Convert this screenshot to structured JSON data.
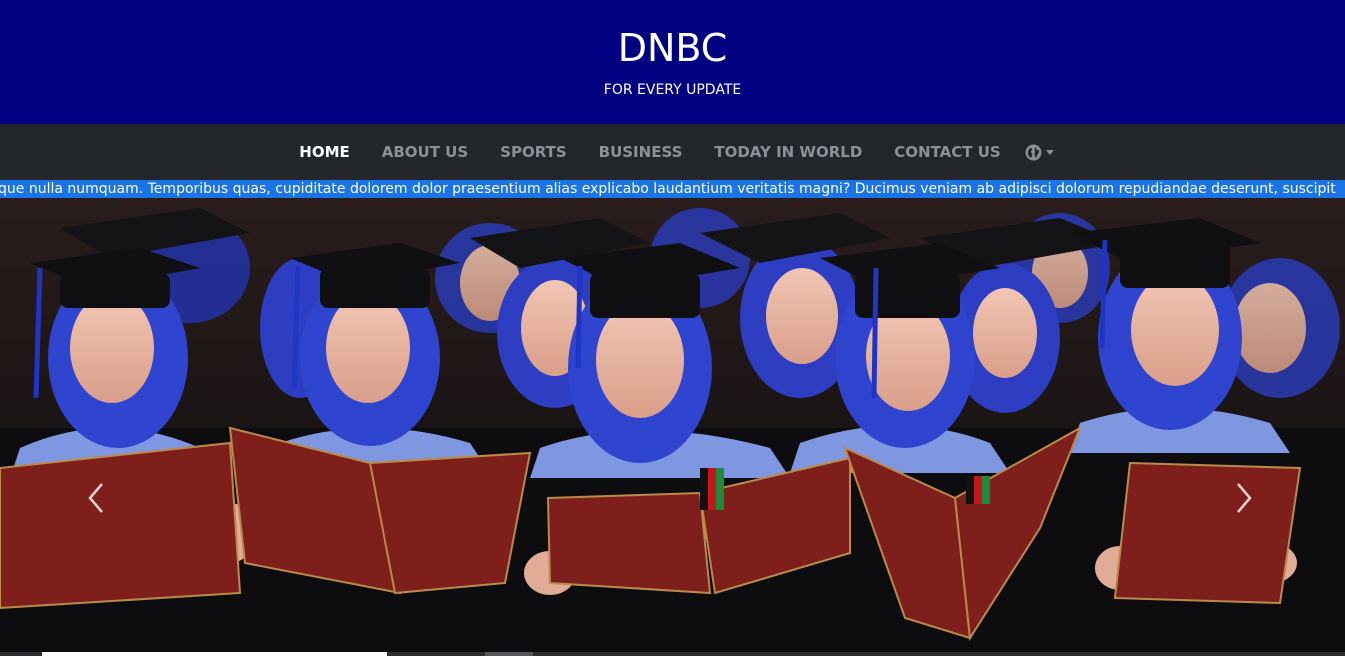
{
  "header": {
    "title": "DNBC",
    "tagline": "FOR EVERY UPDATE",
    "background": "#010080"
  },
  "nav": {
    "items": [
      {
        "label": "HOME",
        "active": true
      },
      {
        "label": "ABOUT US"
      },
      {
        "label": "SPORTS"
      },
      {
        "label": "BUSINESS"
      },
      {
        "label": "TODAY IN WORLD"
      },
      {
        "label": "CONTACT US"
      }
    ],
    "language_icon": "globe-icon",
    "background": "#23272b"
  },
  "ticker": {
    "text": "que nulla numquam. Temporibus quas, cupiditate dolorem dolor praesentium alias explicabo laudantium veritatis magni? Ducimus veniam ab adipisci dolorum repudiandae deserunt, suscipit",
    "background": "#1a74e8"
  },
  "carousel": {
    "prev_icon": "chevron-left-icon",
    "next_icon": "chevron-right-icon",
    "image_subject": "graduates in caps and blue hoods reading from red folders"
  }
}
